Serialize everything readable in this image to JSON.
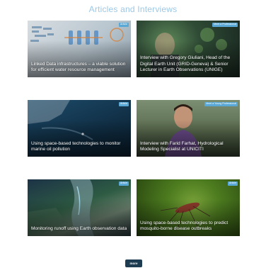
{
  "section": {
    "title": "Articles and Interviews"
  },
  "cards": [
    {
      "title": "Linked Data infrastructures – a viable solution for efficient water resource management",
      "badge": "Article"
    },
    {
      "title": "Interview with Gregory Giuliani, Head of the Digital Earth Unit (GRID-Geneva) & Senior Lecturer in Earth Observations (UNIGE)",
      "badge": "Meet a Professional"
    },
    {
      "title": "Using space-based technologies to monitor marine oil pollution",
      "badge": "Article"
    },
    {
      "title": "Interview with Farid Farhat, Hydrological Modeling Specialist at UNICITI",
      "badge": "Meet a Young Professional"
    },
    {
      "title": "Monitoring runoff using Earth observation data",
      "badge": "Article"
    },
    {
      "title": "Using space-based technologies to predict mosquito-borne disease outbreaks",
      "badge": "Article"
    }
  ],
  "more_button": {
    "label": "more"
  },
  "colors": {
    "title": "#9cc8e6",
    "badge": "#5aa8d6",
    "button": "#1d3c52"
  }
}
